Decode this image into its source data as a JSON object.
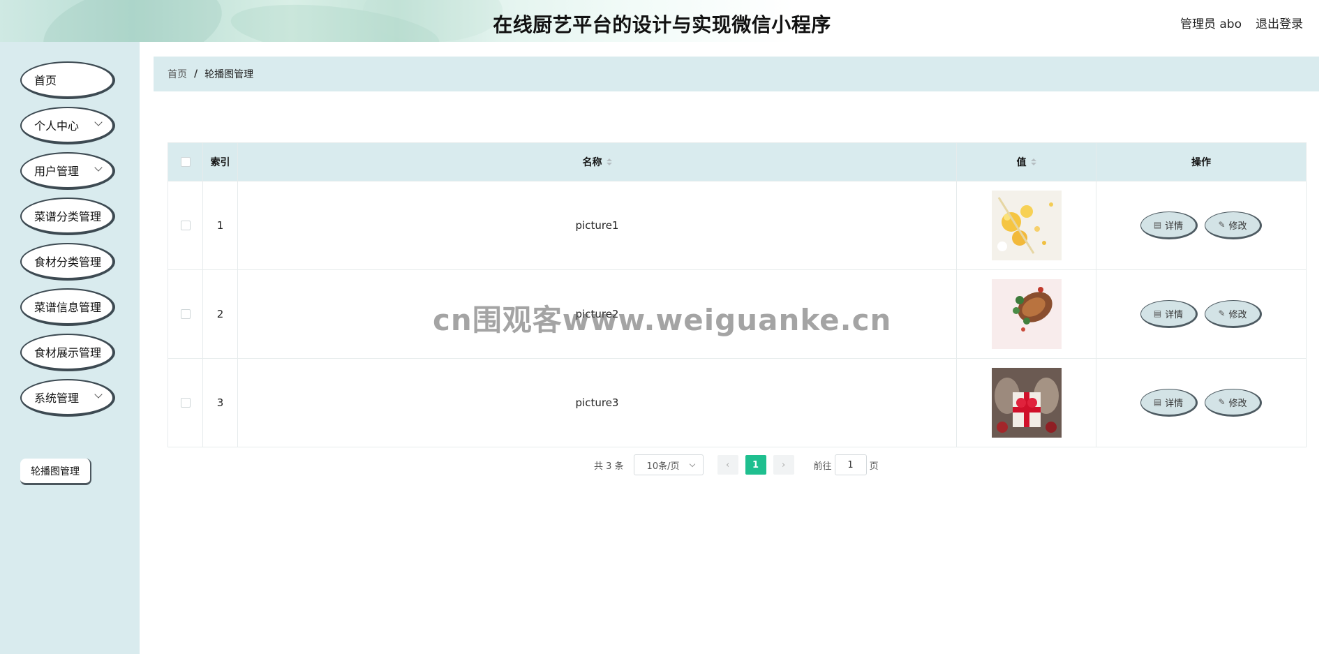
{
  "header": {
    "title": "在线厨艺平台的设计与实现微信小程序",
    "user_label": "管理员 abo",
    "logout_label": "退出登录"
  },
  "sidebar": {
    "items": [
      {
        "label": "首页",
        "has_children": false
      },
      {
        "label": "个人中心",
        "has_children": true
      },
      {
        "label": "用户管理",
        "has_children": true
      },
      {
        "label": "菜谱分类管理",
        "has_children": false
      },
      {
        "label": "食材分类管理",
        "has_children": false
      },
      {
        "label": "菜谱信息管理",
        "has_children": false
      },
      {
        "label": "食材展示管理",
        "has_children": false
      },
      {
        "label": "系统管理",
        "has_children": true
      }
    ],
    "submenu": {
      "label": "轮播图管理"
    }
  },
  "breadcrumb": {
    "home": "首页",
    "separator": "/",
    "current": "轮播图管理"
  },
  "table": {
    "columns": {
      "index": "索引",
      "name": "名称",
      "value": "值",
      "actions": "操作"
    },
    "rows": [
      {
        "index": "1",
        "name": "picture1",
        "thumb": "yellow-flowers"
      },
      {
        "index": "2",
        "name": "picture2",
        "thumb": "roast-dish"
      },
      {
        "index": "3",
        "name": "picture3",
        "thumb": "gift-ribbon"
      }
    ],
    "detail_label": "详情",
    "edit_label": "修改"
  },
  "pagination": {
    "total_text": "共 3 条",
    "page_size": "10条/页",
    "current_page": "1",
    "goto_prefix": "前往",
    "goto_value": "1",
    "goto_suffix": "页",
    "accent_color": "#1fbf8f"
  },
  "watermark": "cn围观客www.weiguanke.cn",
  "colors": {
    "sidebar_bg": "#d9ebee",
    "header_bg": "#d9ebee",
    "button_bg": "#d3e3e6"
  }
}
